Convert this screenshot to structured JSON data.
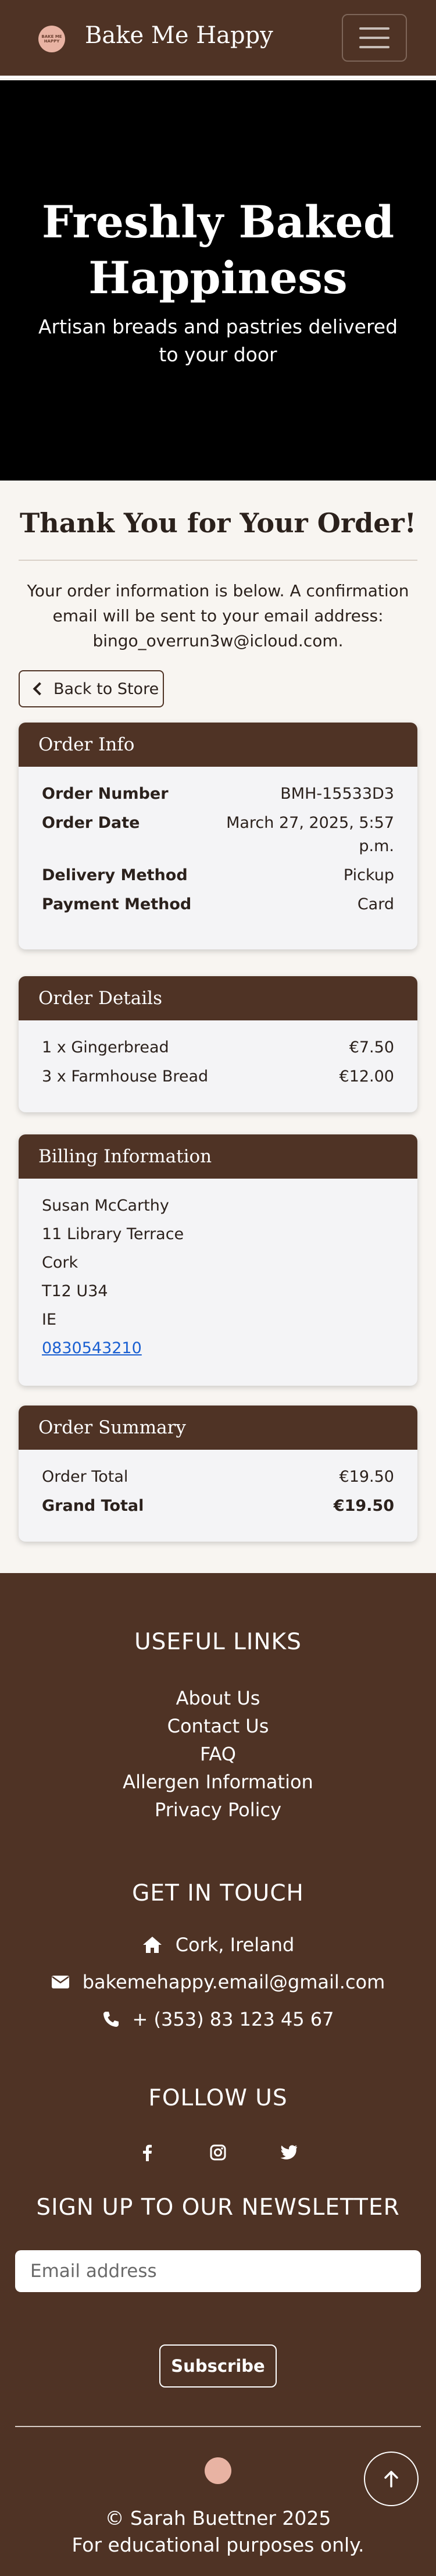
{
  "nav": {
    "brand": "Bake Me Happy",
    "logo_text": "BAKE ME HAPPY"
  },
  "hero": {
    "title_line1": "Freshly Baked",
    "title_line2": "Happiness",
    "subtitle": "Artisan breads and pastries delivered to your door"
  },
  "confirmation": {
    "heading": "Thank You for Your Order!",
    "intro": "Your order information is below. A confirmation email will be sent to your email address: bingo_overrun3w@icloud.com.",
    "back_label": "Back to Store"
  },
  "order_info": {
    "title": "Order Info",
    "rows": [
      {
        "label": "Order Number",
        "value": "BMH-15533D3"
      },
      {
        "label": "Order Date",
        "value": "March 27, 2025, 5:57 p.m."
      },
      {
        "label": "Delivery Method",
        "value": "Pickup"
      },
      {
        "label": "Payment Method",
        "value": "Card"
      }
    ]
  },
  "order_details": {
    "title": "Order Details",
    "items": [
      {
        "label": "1 x Gingerbread",
        "value": "€7.50"
      },
      {
        "label": "3 x Farmhouse Bread",
        "value": "€12.00"
      }
    ]
  },
  "billing": {
    "title": "Billing Information",
    "name": "Susan McCarthy",
    "street": "11 Library Terrace",
    "city": "Cork",
    "postcode": "T12 U34",
    "country": "IE",
    "phone": "0830543210"
  },
  "summary": {
    "title": "Order Summary",
    "order_total_label": "Order Total",
    "order_total_value": "€19.50",
    "grand_total_label": "Grand Total",
    "grand_total_value": "€19.50"
  },
  "footer": {
    "useful_links_title": "USEFUL LINKS",
    "links": [
      "About Us",
      "Contact Us",
      "FAQ",
      "Allergen Information",
      "Privacy Policy"
    ],
    "get_in_touch_title": "GET IN TOUCH",
    "location": "Cork, Ireland",
    "email": "bakemehappy.email@gmail.com",
    "phone": "+ (353) 83 123 45 67",
    "follow_title": "FOLLOW US",
    "social_icons": [
      "facebook-icon",
      "instagram-icon",
      "twitter-icon"
    ],
    "newsletter_title": "SIGN UP TO OUR NEWSLETTER",
    "email_placeholder": "Email address",
    "subscribe_label": "Subscribe",
    "copyright": "© Sarah Buettner 2025",
    "disclaimer": "For educational purposes only."
  },
  "colors": {
    "brand_brown": "#4f3325",
    "page_bg": "#f8f5f1",
    "link_blue": "#1a5fd1",
    "logo_pink": "#e8b3a3"
  }
}
